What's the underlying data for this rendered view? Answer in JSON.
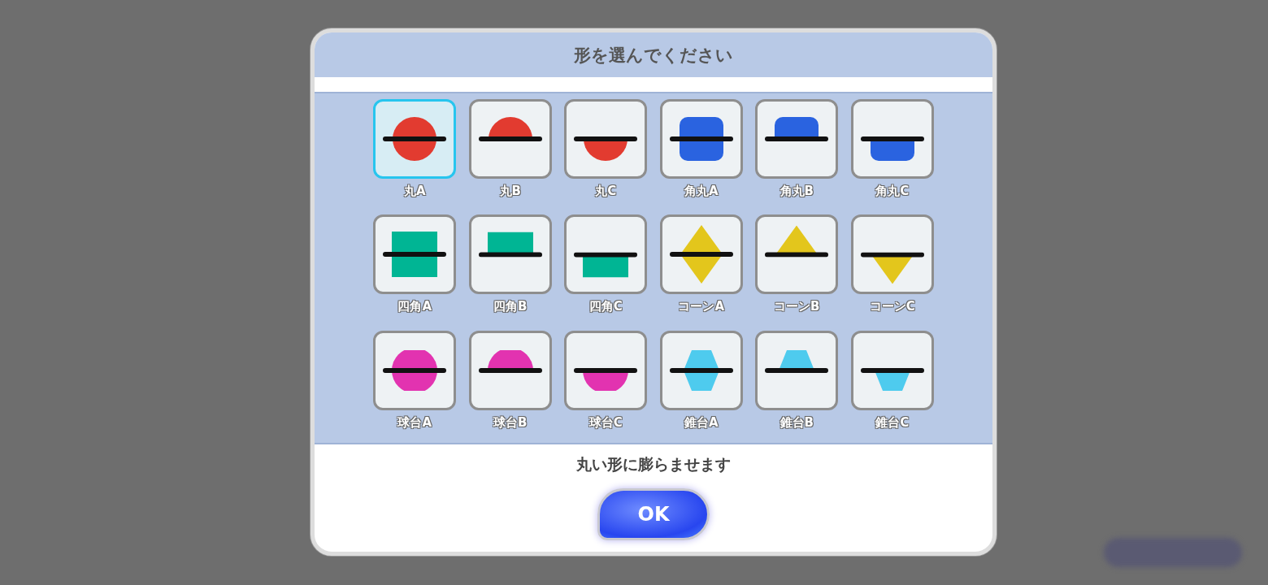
{
  "dialog": {
    "title": "形を選んでください",
    "options": [
      {
        "label": "丸A",
        "kind": "circle",
        "upper": true,
        "lower": true,
        "color": "#e23b30",
        "selected": true
      },
      {
        "label": "丸B",
        "kind": "circle",
        "upper": true,
        "lower": false,
        "color": "#e23b30",
        "selected": false
      },
      {
        "label": "丸C",
        "kind": "circle",
        "upper": false,
        "lower": true,
        "color": "#e23b30",
        "selected": false
      },
      {
        "label": "角丸A",
        "kind": "rounded",
        "upper": true,
        "lower": true,
        "color": "#2a63e0",
        "selected": false
      },
      {
        "label": "角丸B",
        "kind": "rounded",
        "upper": true,
        "lower": false,
        "color": "#2a63e0",
        "selected": false
      },
      {
        "label": "角丸C",
        "kind": "rounded",
        "upper": false,
        "lower": true,
        "color": "#2a63e0",
        "selected": false
      },
      {
        "label": "四角A",
        "kind": "square",
        "upper": true,
        "lower": true,
        "color": "#00b594",
        "selected": false
      },
      {
        "label": "四角B",
        "kind": "square",
        "upper": true,
        "lower": false,
        "color": "#00b594",
        "selected": false
      },
      {
        "label": "四角C",
        "kind": "square",
        "upper": false,
        "lower": true,
        "color": "#00b594",
        "selected": false
      },
      {
        "label": "コーンA",
        "kind": "cone",
        "upper": true,
        "lower": true,
        "color": "#e3c61c",
        "selected": false
      },
      {
        "label": "コーンB",
        "kind": "cone",
        "upper": true,
        "lower": false,
        "color": "#e3c61c",
        "selected": false
      },
      {
        "label": "コーンC",
        "kind": "cone",
        "upper": false,
        "lower": true,
        "color": "#e3c61c",
        "selected": false
      },
      {
        "label": "球台A",
        "kind": "ball",
        "upper": true,
        "lower": true,
        "color": "#e233b0",
        "selected": false
      },
      {
        "label": "球台B",
        "kind": "ball",
        "upper": true,
        "lower": false,
        "color": "#e233b0",
        "selected": false
      },
      {
        "label": "球台C",
        "kind": "ball",
        "upper": false,
        "lower": true,
        "color": "#e233b0",
        "selected": false
      },
      {
        "label": "錐台A",
        "kind": "frustum",
        "upper": true,
        "lower": true,
        "color": "#4ecbee",
        "selected": false
      },
      {
        "label": "錐台B",
        "kind": "frustum",
        "upper": true,
        "lower": false,
        "color": "#4ecbee",
        "selected": false
      },
      {
        "label": "錐台C",
        "kind": "frustum",
        "upper": false,
        "lower": true,
        "color": "#4ecbee",
        "selected": false
      }
    ],
    "description": "丸い形に膨らませます",
    "ok_button": "OK"
  }
}
